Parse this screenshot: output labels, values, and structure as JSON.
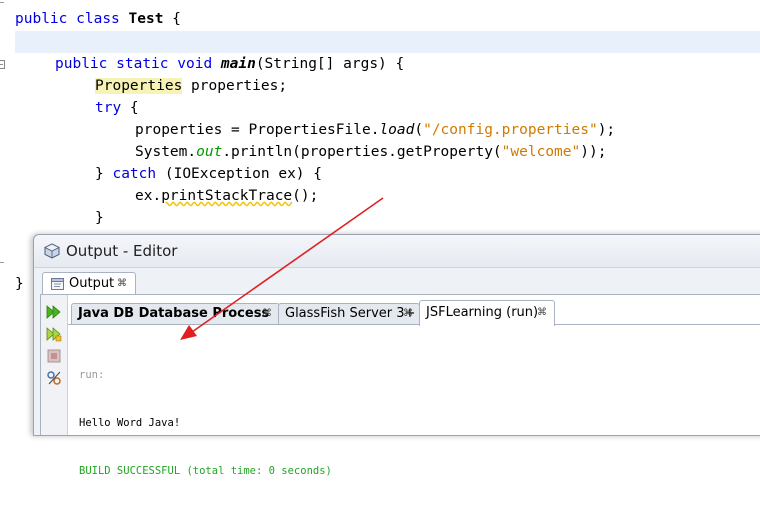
{
  "editor": {
    "class_line": {
      "kw1": "public",
      "kw2": "class",
      "name": "Test",
      "brace": "{"
    },
    "main_line": {
      "kw1": "public",
      "kw2": "static",
      "kw3": "void",
      "method": "main",
      "rest": "(String[] args) {"
    },
    "props_decl": {
      "type": "Properties",
      "rest": " properties;"
    },
    "try_line": {
      "kw": "try",
      "rest": " {"
    },
    "load_line": {
      "pre": "properties = PropertiesFile.",
      "method": "load",
      "open": "(",
      "str": "\"/config.properties\"",
      "close": ");"
    },
    "println_line": {
      "pre": "System.",
      "field": "out",
      "mid": ".println(properties.getProperty(",
      "str": "\"welcome\"",
      "close": "));"
    },
    "catch_line": {
      "pre": "} ",
      "kw": "catch",
      "rest": " (IOException ex) {"
    },
    "stack_line": {
      "pre": "ex.",
      "method": "printStackTrace",
      "rest": "();"
    },
    "close_inner": "}",
    "close_outer": "}"
  },
  "output_window": {
    "title": "Output - Editor",
    "outer_tab": {
      "label": "Output",
      "close": "⌘"
    },
    "tabs": [
      {
        "label": "Java DB Database Process",
        "close": "⌘"
      },
      {
        "label": "GlassFish Server 3+",
        "close": "⌘"
      },
      {
        "label": "JSFLearning (run)",
        "close": "⌘"
      }
    ],
    "console_lines": [
      "run:",
      "Hello Word Java!",
      "BUILD SUCCESSFUL (total time: 0 seconds)"
    ]
  },
  "colors": {
    "keyword": "#0000e6",
    "string": "#ce7b00",
    "field": "#009900",
    "build_success": "#22a522",
    "arrow": "#e02020"
  },
  "icons": [
    "output-window-icon",
    "output-tab-icon",
    "rerun-icon",
    "rerun-different-params-icon",
    "stop-icon",
    "settings-icon"
  ]
}
